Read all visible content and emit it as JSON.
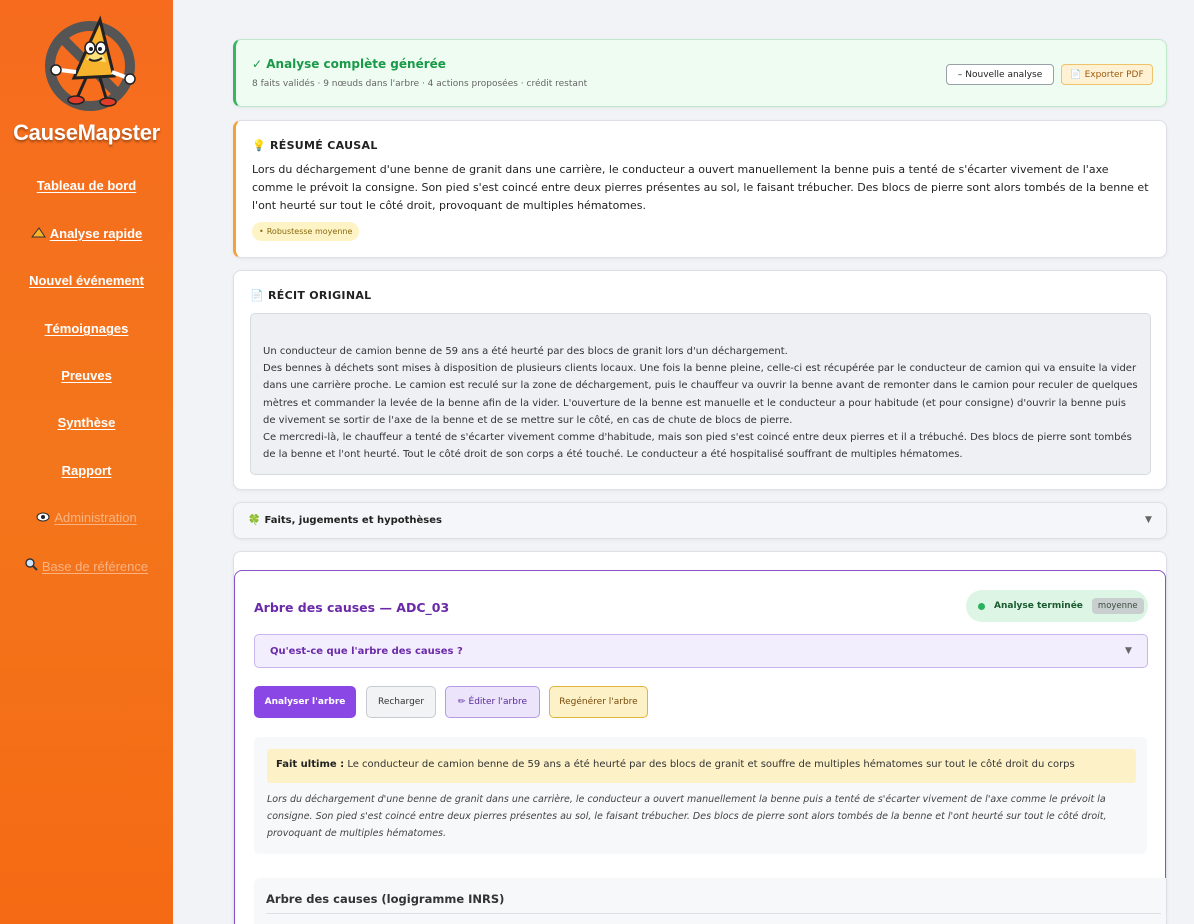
{
  "sidebar": {
    "brand": "CauseMapster",
    "items": [
      {
        "label": "Tableau de bord",
        "icon": ""
      },
      {
        "label": "Analyse rapide",
        "icon": "triangle-icon"
      },
      {
        "label": "Nouvel événement",
        "icon": ""
      },
      {
        "label": "Témoignages",
        "icon": ""
      },
      {
        "label": "Preuves",
        "icon": ""
      },
      {
        "label": "Synthèse",
        "icon": ""
      },
      {
        "label": "Rapport",
        "icon": ""
      },
      {
        "label": "Administration",
        "icon": "eye-icon"
      },
      {
        "label": "Base de référence",
        "icon": "magnifier-icon"
      }
    ]
  },
  "success": {
    "title": "✓ Analyse complète générée",
    "subtitle": "8 faits validés · 9 nœuds dans l'arbre · 4 actions proposées · crédit restant",
    "new_label": "Nouvelle analyse",
    "new_icon": "–",
    "pdf_label": "Exporter PDF",
    "pdf_icon": "📄"
  },
  "summary": {
    "icon": "💡",
    "title": "RÉSUMÉ CAUSAL",
    "text": "Lors du déchargement d'une benne de granit dans une carrière, le conducteur a ouvert manuellement la benne puis a tenté de s'écarter vivement de l'axe comme le prévoit la consigne. Son pied s'est coincé entre deux pierres présentes au sol, le faisant trébucher. Des blocs de pierre sont alors tombés de la benne et l'ont heurté sur tout le côté droit, provoquant de multiples hématomes.",
    "badge": "Robustesse moyenne",
    "badge_dot": "•"
  },
  "story": {
    "icon": "📄",
    "title": "RÉCIT ORIGINAL",
    "lines": [
      "Un conducteur de camion benne de 59 ans a été heurté par des blocs de granit lors d'un déchargement.",
      "Des bennes à déchets sont mises à disposition de plusieurs clients locaux. Une fois la benne pleine, celle-ci est récupérée par le conducteur de camion qui va ensuite la vider dans une carrière proche. Le camion est reculé sur la zone de déchargement, puis le chauffeur va ouvrir la benne avant de remonter dans le camion pour reculer de quelques mètres et commander la levée de la benne afin de la vider. L'ouverture de la benne est manuelle et le conducteur a pour habitude (et pour consigne) d'ouvrir la benne puis de vivement se sortir de l'axe de la benne et de se mettre sur le côté, en cas de chute de blocs de pierre.",
      "Ce mercredi-là, le chauffeur a tenté de s'écarter vivement comme d'habitude, mais son pied s'est coincé entre deux pierres et il a trébuché. Des blocs de pierre sont tombés de la benne et l'ont heurté. Tout le côté droit de son corps a été touché. Le conducteur a été hospitalisé souffrant de multiples hématomes."
    ]
  },
  "facts": {
    "icon": "🍀",
    "title": "Faits, jugements et hypothèses",
    "caret": "▼"
  },
  "tree": {
    "title": "Arbre des causes — ADC_03",
    "status": "Analyse terminée",
    "status_chip": "moyenne",
    "what_label": "Qu'est-ce que l'arbre des causes ?",
    "what_caret": "▼",
    "buttons": {
      "analyse": "Analyser l'arbre",
      "reload": "Recharger",
      "edit": "Éditer l'arbre",
      "edit_icon": "✏",
      "regen": "Regénérer l'arbre"
    },
    "fact_label": "Fait ultime :",
    "fact_text": "Le conducteur de camion benne de 59 ans a été heurté par des blocs de granit et souffre de multiples hématomes sur tout le côté droit du corps",
    "fact_desc": "Lors du déchargement d'une benne de granit dans une carrière, le conducteur a ouvert manuellement la benne puis a tenté de s'écarter vivement de l'axe comme le prévoit la consigne. Son pied s'est coincé entre deux pierres présentes au sol, le faisant trébucher. Des blocs de pierre sont alors tombés de la benne et l'ont heurté sur tout le côté droit, provoquant de multiples hématomes.",
    "logigramme_title": "Arbre des causes (logigramme INRS)"
  },
  "colors": {
    "sidebar": "#f66b1e",
    "success": "#1a9a48",
    "accent_purple": "#8b47e6",
    "summary_border": "#f3a23a"
  }
}
